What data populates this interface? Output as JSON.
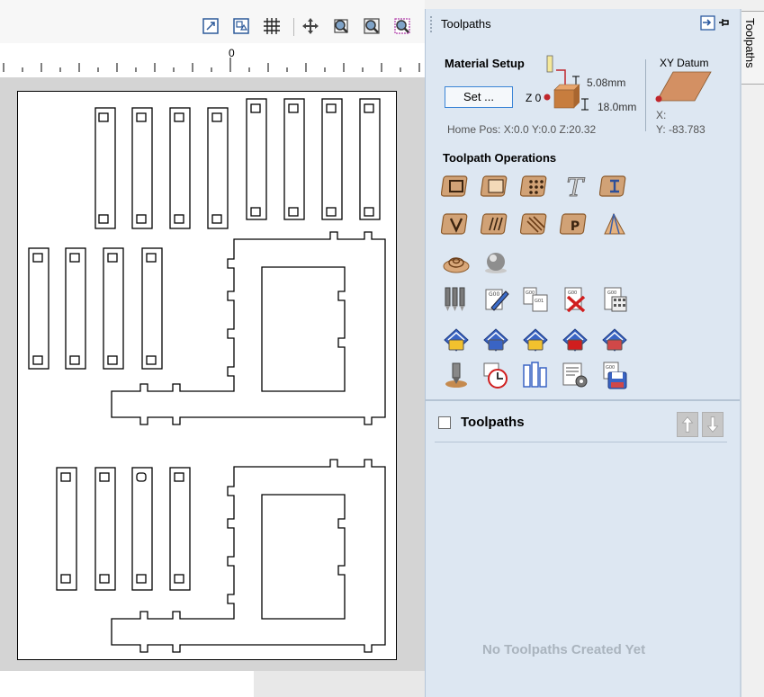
{
  "canvas": {
    "ruler_zero": "0",
    "toolbar_icons": [
      "fit-to-view-icon",
      "zoom-box-icon",
      "grid-icon",
      "pan-icon",
      "zoom-in-icon",
      "zoom-out-icon",
      "zoom-selection-icon"
    ]
  },
  "panel": {
    "title": "Toolpaths",
    "side_tab_label": "Toolpaths",
    "material_setup": {
      "title": "Material Setup",
      "set_button": "Set ...",
      "z_zero_label": "Z 0",
      "clearance_value": "5.08mm",
      "thickness_value": "18.0mm",
      "home_pos": "Home Pos:  X:0.0 Y:0.0 Z:20.32",
      "xy_datum_title": "XY Datum",
      "x_label": "X:",
      "y_label": "Y: -83.783"
    },
    "operations_title": "Toolpath Operations",
    "operations": [
      [
        "profile-toolpath-icon",
        "pocket-toolpath-icon",
        "drilling-toolpath-icon",
        "engraving-toolpath-icon",
        "inlay-toolpath-icon"
      ],
      [
        "vcarve-toolpath-icon",
        "fluting-toolpath-icon",
        "texture-toolpath-icon",
        "prism-carve-toolpath-icon",
        "moulding-toolpath-icon"
      ],
      [
        "3d-roughing-toolpath-icon",
        "3d-finishing-toolpath-icon"
      ],
      [
        "merge-toolpaths-icon",
        "edit-toolpath-icon",
        "recalculate-icon",
        "delete-toolpath-icon",
        "estimate-time-icon"
      ],
      [
        "save-toolpath-folder-icon",
        "save-toolpath-icon",
        "save-visible-icon",
        "toolpath-template-icon",
        "save-nested-icon"
      ],
      [
        "preview-toolpath-icon",
        "time-estimate-icon",
        "machining-order-icon",
        "toolpath-settings-icon",
        "save-all-icon"
      ]
    ],
    "toolpath_list": {
      "header": "Toolpaths",
      "empty_message": "No Toolpaths Created Yet"
    }
  },
  "colors": {
    "panel_bg": "#dde7f2",
    "accent": "#3a84d6",
    "datum_red": "#c0262c"
  }
}
